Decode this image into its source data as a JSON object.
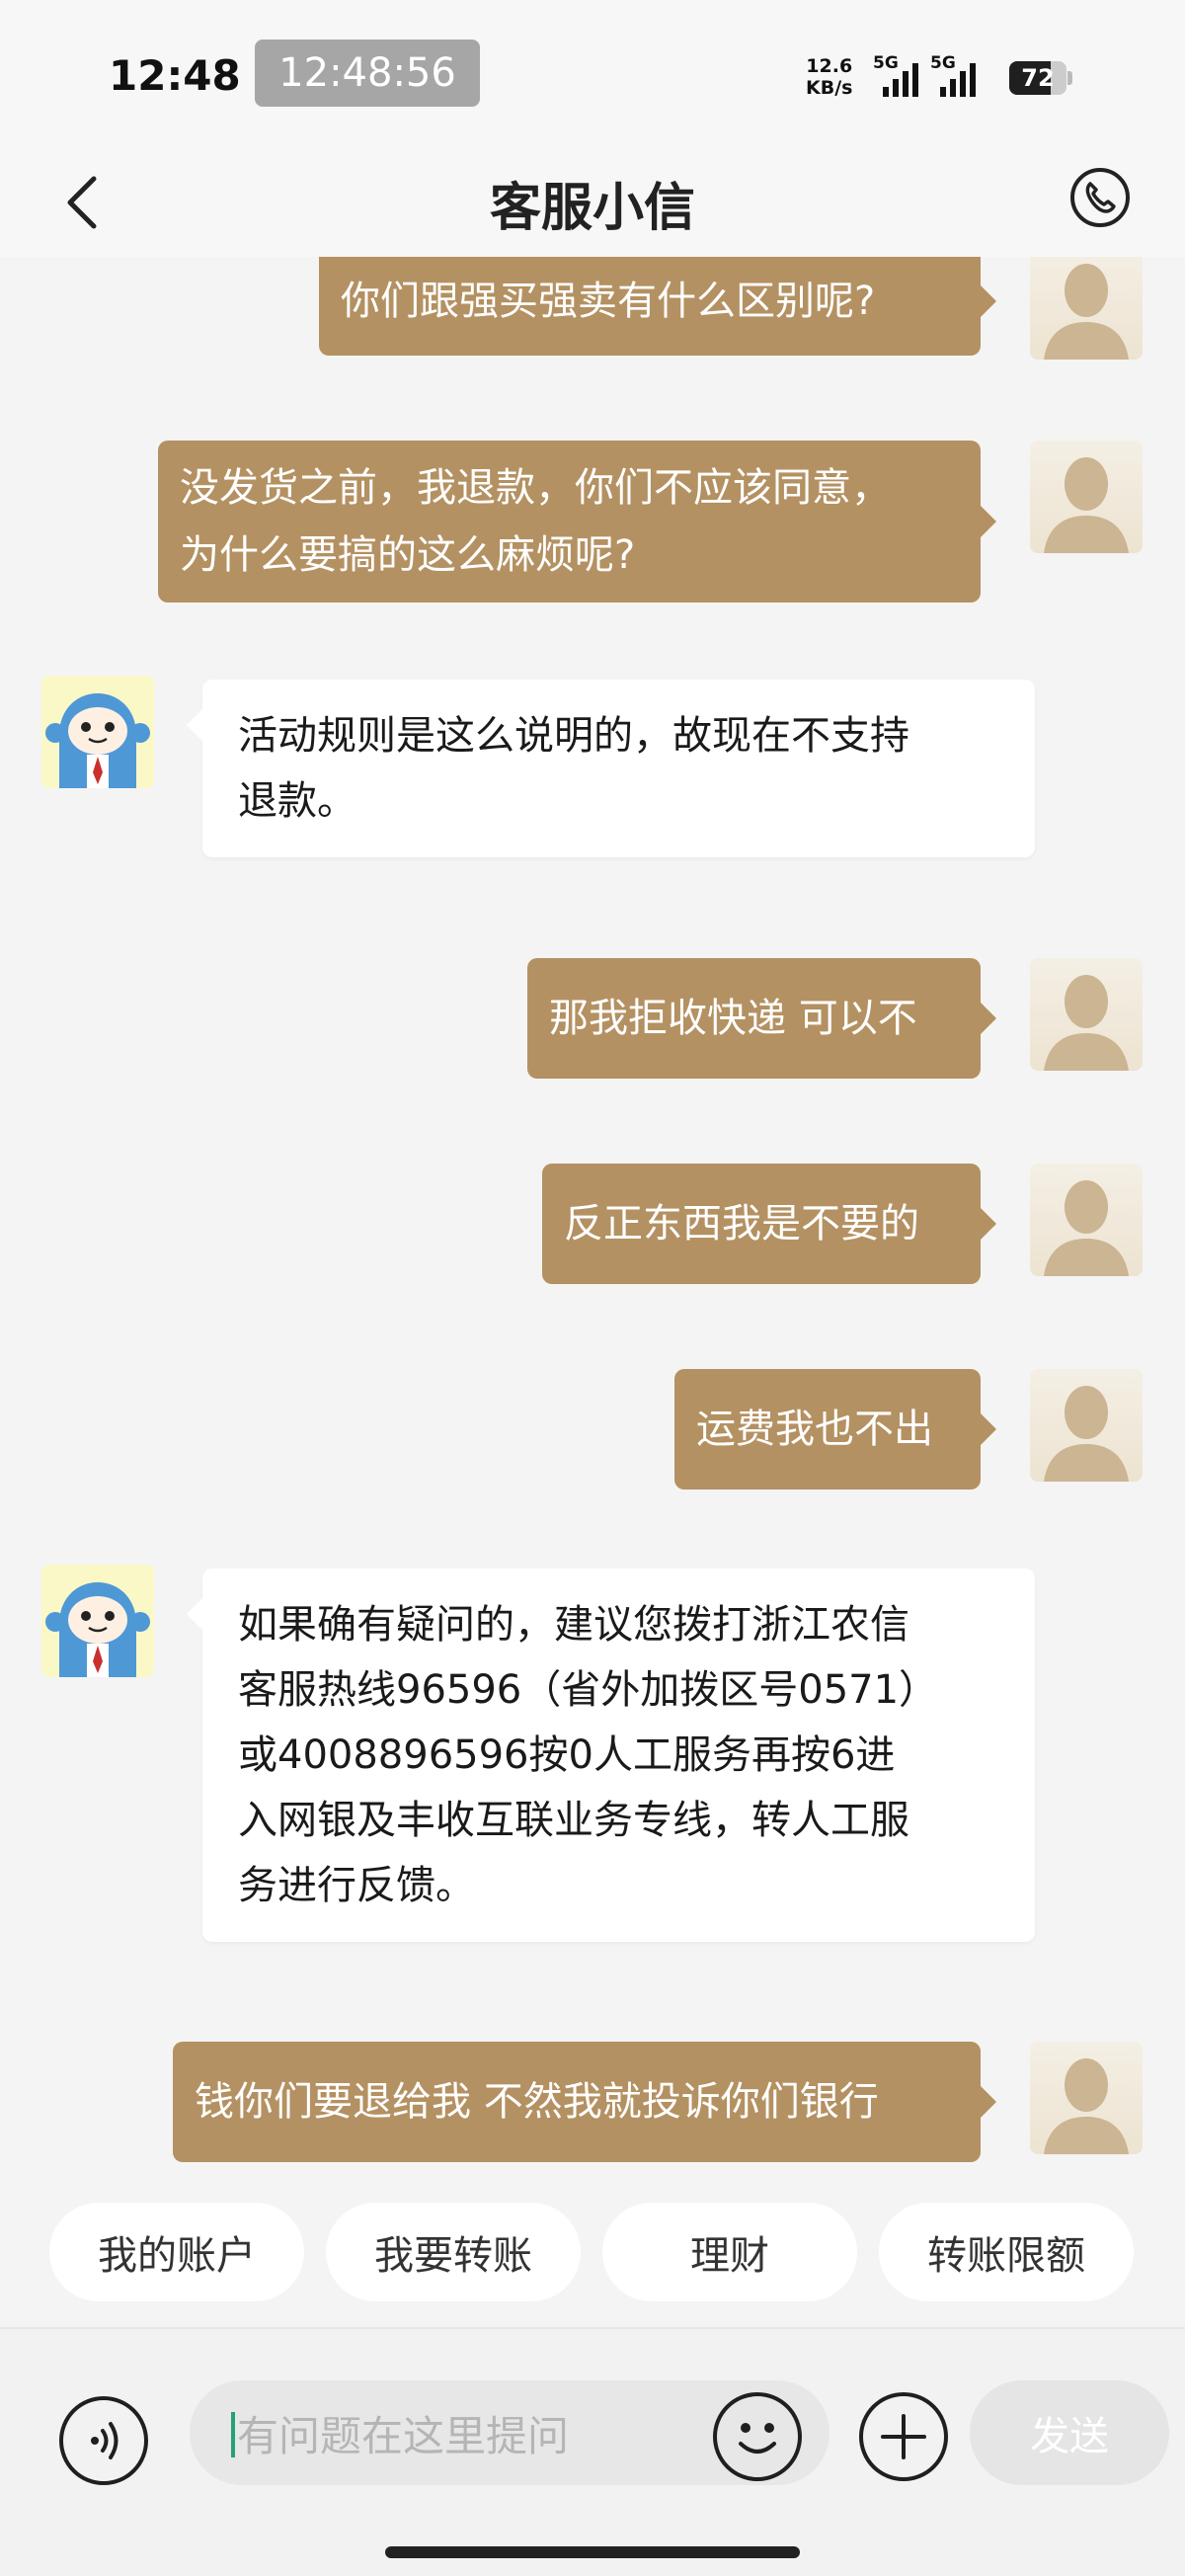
{
  "status_bar": {
    "time": "12:48",
    "timer": "12:48:56",
    "net_speed_value": "12.6",
    "net_speed_unit": "KB/s",
    "sim1_label": "5G",
    "sim2_label": "5G",
    "battery": "72",
    "battery_level": 0.72
  },
  "header": {
    "title": "客服小信"
  },
  "messages": [
    {
      "from": "user",
      "text": "你们跟强买强卖有什么区别呢?"
    },
    {
      "from": "user",
      "lines": [
        "没发货之前，我退款，你们不应该同意，",
        "为什么要搞的这么麻烦呢?"
      ]
    },
    {
      "from": "bot",
      "lines": [
        "活动规则是这么说明的，故现在不支持",
        "退款。"
      ]
    },
    {
      "from": "user",
      "text": "那我拒收快递 可以不"
    },
    {
      "from": "user",
      "text": "反正东西我是不要的"
    },
    {
      "from": "user",
      "text": "运费我也不出"
    },
    {
      "from": "bot",
      "lines": [
        "如果确有疑问的，建议您拨打浙江农信",
        "客服热线96596（省外加拨区号0571）",
        "或4008896596按0人工服务再按6进",
        "入网银及丰收互联业务专线，转人工服",
        "务进行反馈。"
      ]
    },
    {
      "from": "user",
      "text": "钱你们要退给我 不然我就投诉你们银行"
    }
  ],
  "quick_replies": [
    "我的账户",
    "我要转账",
    "理财",
    "转账限额"
  ],
  "input": {
    "placeholder": "有问题在这里提问",
    "value": ""
  },
  "send_label": "发送",
  "colors": {
    "user_bubble": "#b49162",
    "bot_bubble": "#ffffff",
    "background": "#f4f4f4",
    "cursor": "#27a07a"
  },
  "icons": {
    "back": "chevron-left-icon",
    "phone": "phone-icon",
    "voice": "voice-icon",
    "emoji": "smiley-icon",
    "plus": "plus-icon",
    "avatar_user": "user-silhouette-icon",
    "avatar_bot": "bot-mascot-icon"
  }
}
